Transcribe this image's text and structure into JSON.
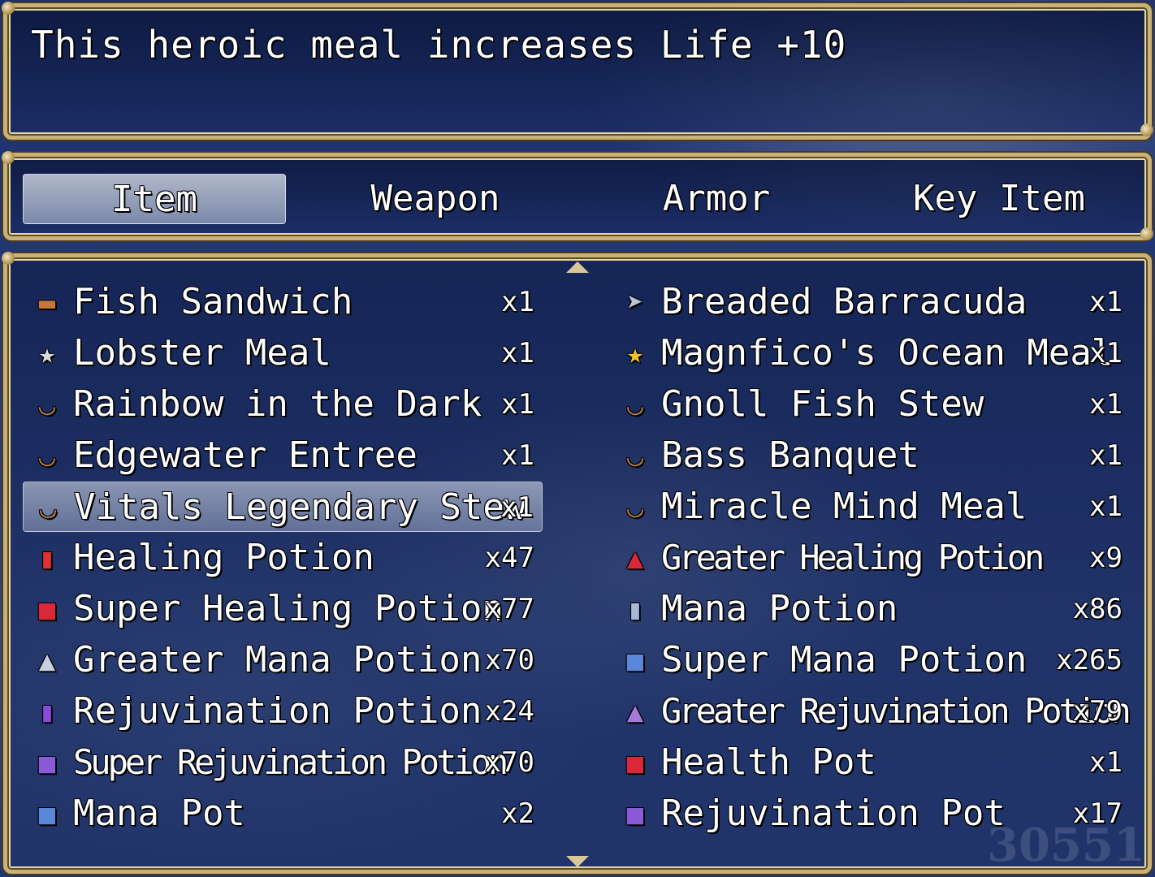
{
  "help": {
    "text": "This heroic meal increases Life +10"
  },
  "tabs": [
    {
      "label": "Item",
      "selected": true
    },
    {
      "label": "Weapon",
      "selected": false
    },
    {
      "label": "Armor",
      "selected": false
    },
    {
      "label": "Key Item",
      "selected": false
    }
  ],
  "items": {
    "left": [
      {
        "name": "Fish Sandwich",
        "qty": "x1",
        "icon": "bread-icon"
      },
      {
        "name": "Lobster Meal",
        "qty": "x1",
        "icon": "silver-star-icon"
      },
      {
        "name": "Rainbow in the Dark",
        "qty": "x1",
        "icon": "bowl-icon"
      },
      {
        "name": "Edgewater Entree",
        "qty": "x1",
        "icon": "bowl-icon"
      },
      {
        "name": "Vitals Legendary Stew",
        "qty": "x1",
        "icon": "bowl-icon",
        "selected": true
      },
      {
        "name": "Healing Potion",
        "qty": "x47",
        "icon": "red-vial-icon"
      },
      {
        "name": "Super Healing Potion",
        "qty": "x77",
        "icon": "red-jar-icon"
      },
      {
        "name": "Greater Mana Potion",
        "qty": "x70",
        "icon": "flask-icon"
      },
      {
        "name": "Rejuvination Potion",
        "qty": "x24",
        "icon": "purple-vial-icon"
      },
      {
        "name": "Super Rejuvination Potion",
        "qty": "x70",
        "icon": "purple-jar-icon"
      },
      {
        "name": "Mana Pot",
        "qty": "x2",
        "icon": "blue-jar-icon"
      }
    ],
    "right": [
      {
        "name": "Breaded Barracuda",
        "qty": "x1",
        "icon": "fish-icon"
      },
      {
        "name": "Magnfico's Ocean Meal",
        "qty": "x1",
        "icon": "gold-star-icon"
      },
      {
        "name": "Gnoll Fish Stew",
        "qty": "x1",
        "icon": "bowl-icon"
      },
      {
        "name": "Bass Banquet",
        "qty": "x1",
        "icon": "bowl-icon"
      },
      {
        "name": "Miracle Mind Meal",
        "qty": "x1",
        "icon": "bowl-icon"
      },
      {
        "name": "Greater Healing Potion",
        "qty": "x9",
        "icon": "red-flask-icon"
      },
      {
        "name": "Mana Potion",
        "qty": "x86",
        "icon": "blue-vial-icon"
      },
      {
        "name": "Super Mana Potion",
        "qty": "x265",
        "icon": "blue-jar-icon"
      },
      {
        "name": "Greater Rejuvination Potion",
        "qty": "x79",
        "icon": "purple-flask-icon"
      },
      {
        "name": "Health Pot",
        "qty": "x1",
        "icon": "red-jar-icon"
      },
      {
        "name": "Rejuvination Pot",
        "qty": "x17",
        "icon": "purple-jar-icon"
      }
    ]
  },
  "background": {
    "gold_number": "30551"
  },
  "colors": {
    "frame": "#c8b27a",
    "window": "#142a66",
    "text": "#ffffff"
  }
}
